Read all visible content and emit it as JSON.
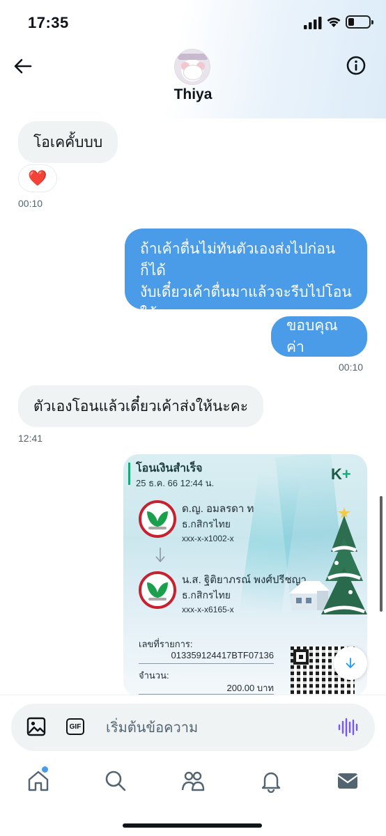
{
  "status_bar": {
    "time": "17:35"
  },
  "header": {
    "contact_name": "Thiya"
  },
  "messages": [
    {
      "direction": "in",
      "text": "โอเคคั้บบบ"
    },
    {
      "direction": "in",
      "reaction": "❤️",
      "time": "00:10"
    },
    {
      "direction": "out",
      "lines": [
        "ถ้าเค้าตื่นไม่ทันตัวเองส่งไปก่อนก็ได้",
        "งับเดี๋ยวเค้าตื่นมาแล้วจะรีบไปโอน",
        "ให้"
      ]
    },
    {
      "direction": "out",
      "text": "ขอบคุณค่า",
      "time": "00:10"
    },
    {
      "direction": "in",
      "text": "ตัวเองโอนแล้วเดี๋ยวเค้าส่งให้นะคะ",
      "time": "12:41"
    }
  ],
  "slip": {
    "title": "โอนเงินสำเร็จ",
    "datetime": "25 ธ.ค. 66  12:44 น.",
    "brand": "K",
    "brand_plus": "+",
    "sender": {
      "name": "ด.ญ. อมลรดา ท",
      "bank": "ธ.กสิกรไทย",
      "account": "xxx-x-x1002-x"
    },
    "receiver": {
      "name": "น.ส. ฐิติยาภรณ์ พงศ์ปรีชญา",
      "bank": "ธ.กสิกรไทย",
      "account": "xxx-x-x6165-x"
    },
    "ref_label": "เลขที่รายการ:",
    "ref_value": "013359124417BTF07136",
    "amount_label": "จำนวน:",
    "amount_value": "200.00 บาท"
  },
  "composer": {
    "placeholder": "เริ่มต้นข้อความ",
    "gif_label": "GIF"
  },
  "icons": {
    "back": "arrow-left-icon",
    "info": "info-icon",
    "image": "image-icon",
    "gif": "gif-icon",
    "voice": "voice-wave-icon",
    "download": "download-arrow-icon",
    "tabs": [
      "home-icon",
      "search-icon",
      "communities-icon",
      "bell-icon",
      "mail-icon"
    ]
  },
  "colors": {
    "outgoing_bubble": "#4a9be8",
    "incoming_bubble": "#eff3f4",
    "accent": "#1d9bf0",
    "voice": "#7856ff"
  }
}
